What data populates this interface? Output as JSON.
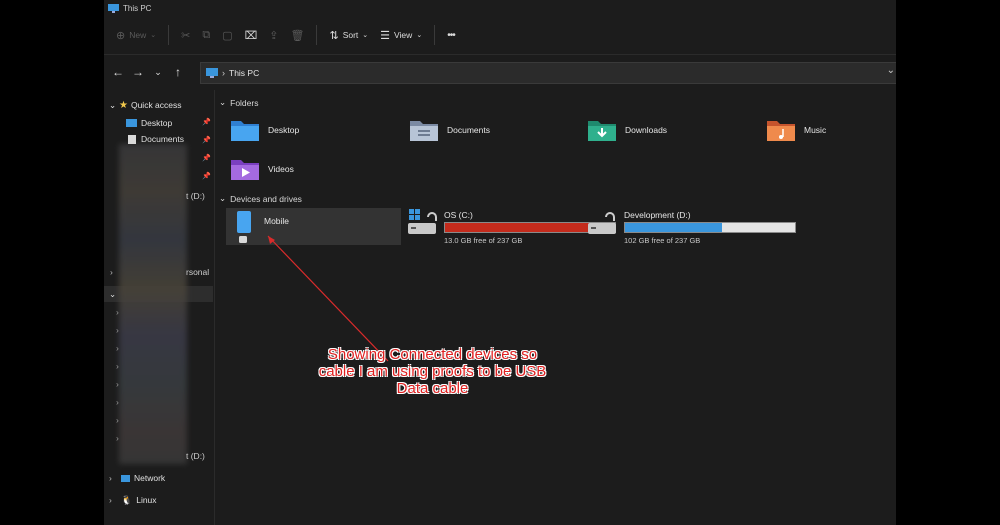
{
  "window": {
    "title": "This PC"
  },
  "toolbar": {
    "new_label": "New",
    "sort_label": "Sort",
    "view_label": "View",
    "more_label": "•••"
  },
  "address": {
    "path": "This PC"
  },
  "sidebar": {
    "quick_access": "Quick access",
    "items": [
      {
        "label": "Desktop"
      },
      {
        "label": "Documents"
      }
    ],
    "fragment_drive1": "t (D:)",
    "fragment_personal": "rsonal",
    "fragment_drive2": "t (D:)",
    "network": "Network",
    "linux": "Linux"
  },
  "content": {
    "folders_heading": "Folders",
    "folders": [
      {
        "label": "Desktop",
        "icon": "desktop-folder-icon"
      },
      {
        "label": "Documents",
        "icon": "documents-folder-icon"
      },
      {
        "label": "Downloads",
        "icon": "downloads-folder-icon"
      },
      {
        "label": "Music",
        "icon": "music-folder-icon"
      },
      {
        "label": "Videos",
        "icon": "videos-folder-icon"
      }
    ],
    "devices_heading": "Devices and drives",
    "mobile_label": "Mobile",
    "drives": [
      {
        "label": "OS (C:)",
        "free_text": "13.0 GB free of 237 GB",
        "used_fraction": 0.945,
        "bar_color": "#c42b1c"
      },
      {
        "label": "Development (D:)",
        "free_text": "102 GB free of 237 GB",
        "used_fraction": 0.57,
        "bar_color": "#3a96dd"
      }
    ]
  },
  "annotation": {
    "lines": [
      "Showing Connected devices so",
      "cable I am using proofs to be USB",
      "Data cable"
    ],
    "color": "#e02020"
  }
}
